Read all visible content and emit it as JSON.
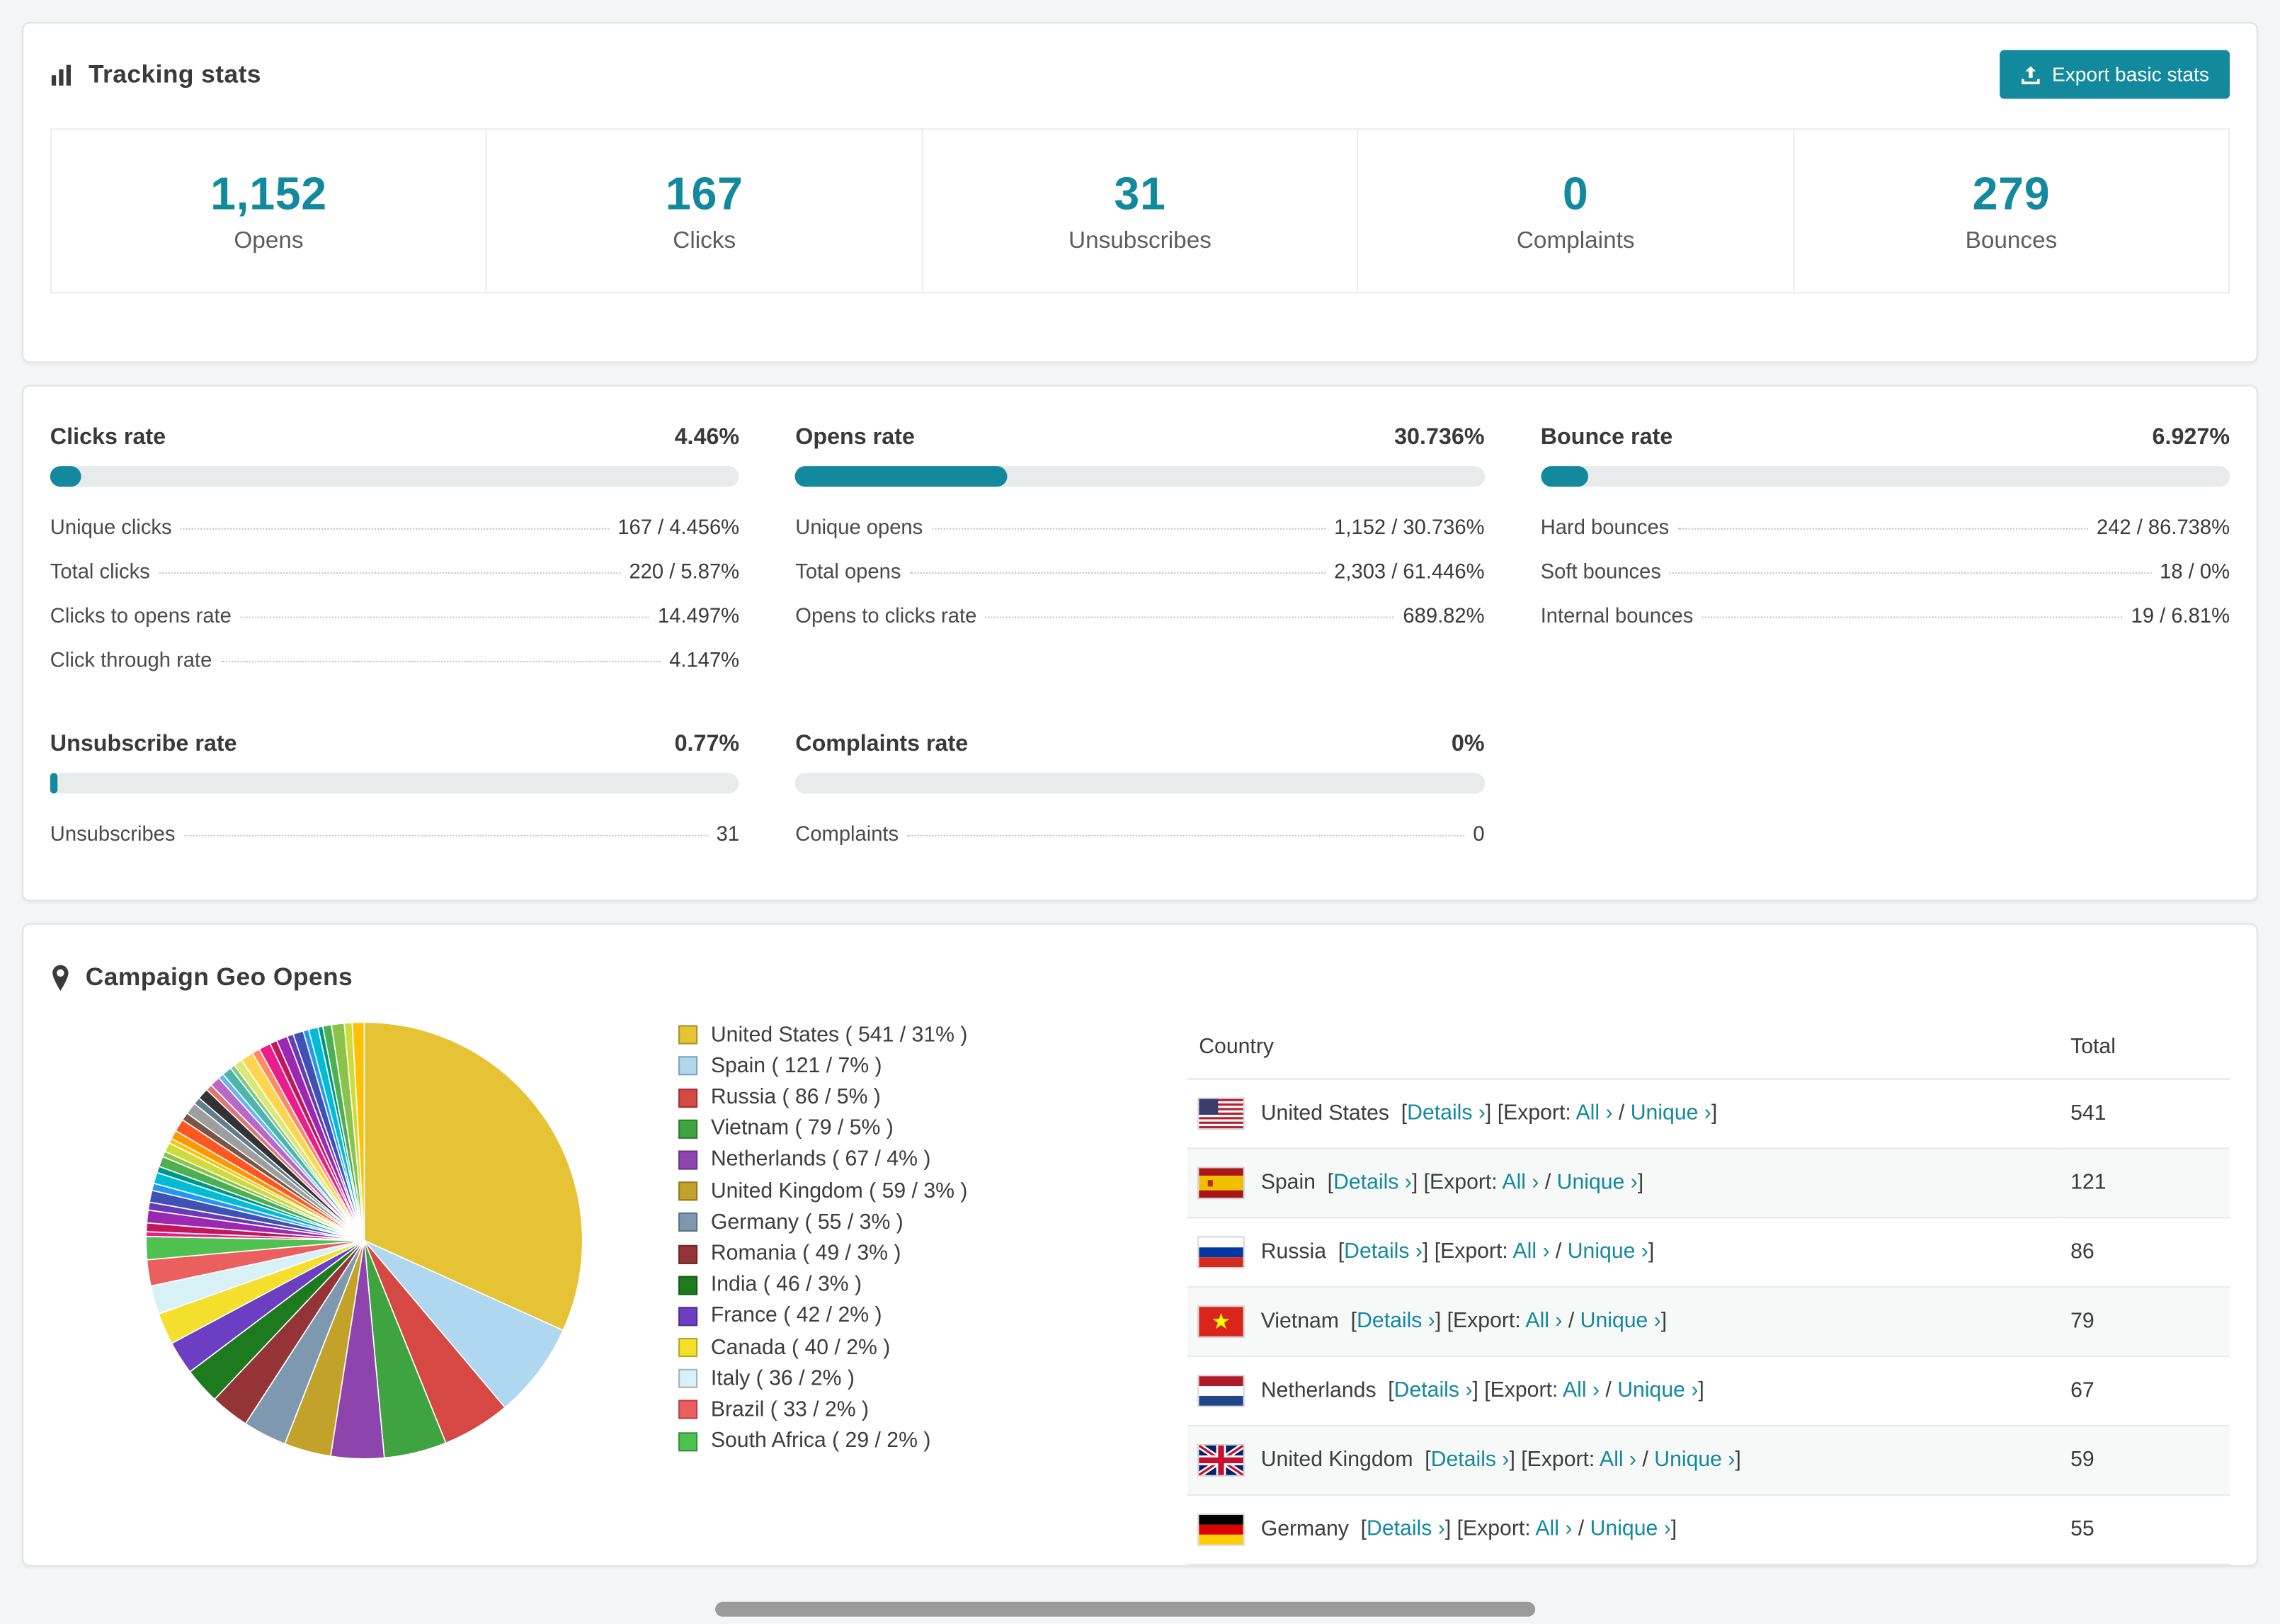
{
  "theme": {
    "accent": "#13899E"
  },
  "tracking": {
    "title": "Tracking stats",
    "export_button": "Export basic stats",
    "stats": [
      {
        "value": "1,152",
        "label": "Opens"
      },
      {
        "value": "167",
        "label": "Clicks"
      },
      {
        "value": "31",
        "label": "Unsubscribes"
      },
      {
        "value": "0",
        "label": "Complaints"
      },
      {
        "value": "279",
        "label": "Bounces"
      }
    ]
  },
  "rates": [
    {
      "title": "Clicks rate",
      "value": "4.46%",
      "percent": 4.46,
      "rows": [
        {
          "label": "Unique clicks",
          "value": "167 / 4.456%"
        },
        {
          "label": "Total clicks",
          "value": "220 / 5.87%"
        },
        {
          "label": "Clicks to opens rate",
          "value": "14.497%"
        },
        {
          "label": "Click through rate",
          "value": "4.147%"
        }
      ]
    },
    {
      "title": "Opens rate",
      "value": "30.736%",
      "percent": 30.736,
      "rows": [
        {
          "label": "Unique opens",
          "value": "1,152 / 30.736%"
        },
        {
          "label": "Total opens",
          "value": "2,303 / 61.446%"
        },
        {
          "label": "Opens to clicks rate",
          "value": "689.82%"
        }
      ]
    },
    {
      "title": "Bounce rate",
      "value": "6.927%",
      "percent": 6.927,
      "rows": [
        {
          "label": "Hard bounces",
          "value": "242 / 86.738%"
        },
        {
          "label": "Soft bounces",
          "value": "18 / 0%"
        },
        {
          "label": "Internal bounces",
          "value": "19 / 6.81%"
        }
      ]
    },
    {
      "title": "Unsubscribe rate",
      "value": "0.77%",
      "percent": 0.77,
      "rows": [
        {
          "label": "Unsubscribes",
          "value": "31"
        }
      ]
    },
    {
      "title": "Complaints rate",
      "value": "0%",
      "percent": 0,
      "rows": [
        {
          "label": "Complaints",
          "value": "0"
        }
      ]
    }
  ],
  "geo": {
    "title": "Campaign Geo Opens",
    "legend": [
      {
        "label": "United States ( 541 / 31% )",
        "color": "#E6C235"
      },
      {
        "label": "Spain ( 121 / 7% )",
        "color": "#AFD7F0"
      },
      {
        "label": "Russia ( 86 / 5% )",
        "color": "#D54843"
      },
      {
        "label": "Vietnam ( 79 / 5% )",
        "color": "#3FA33F"
      },
      {
        "label": "Netherlands ( 67 / 4% )",
        "color": "#8E44AD"
      },
      {
        "label": "United Kingdom ( 59 / 3% )",
        "color": "#C3A22B"
      },
      {
        "label": "Germany ( 55 / 3% )",
        "color": "#7E99AF"
      },
      {
        "label": "Romania ( 49 / 3% )",
        "color": "#943437"
      },
      {
        "label": "India ( 46 / 3% )",
        "color": "#1E7A1E"
      },
      {
        "label": "France ( 42 / 2% )",
        "color": "#6C3FC2"
      },
      {
        "label": "Canada ( 40 / 2% )",
        "color": "#F4E02C"
      },
      {
        "label": "Italy ( 36 / 2% )",
        "color": "#D8F1F6"
      },
      {
        "label": "Brazil ( 33 / 2% )",
        "color": "#EC5F5F"
      },
      {
        "label": "South Africa ( 29 / 2% )",
        "color": "#4FC150"
      }
    ],
    "table": {
      "headers": {
        "country": "Country",
        "total": "Total"
      },
      "link_details": "Details",
      "export_prefix": "Export:",
      "link_all": "All",
      "link_unique": "Unique",
      "chevron": "›",
      "bracket_open": "[",
      "bracket_close": "]",
      "slash": "/",
      "rows": [
        {
          "flag": "us",
          "country": "United States",
          "total": "541"
        },
        {
          "flag": "es",
          "country": "Spain",
          "total": "121"
        },
        {
          "flag": "ru",
          "country": "Russia",
          "total": "86"
        },
        {
          "flag": "vn",
          "country": "Vietnam",
          "total": "79"
        },
        {
          "flag": "nl",
          "country": "Netherlands",
          "total": "67"
        },
        {
          "flag": "gb",
          "country": "United Kingdom",
          "total": "59"
        },
        {
          "flag": "de",
          "country": "Germany",
          "total": "55"
        }
      ]
    }
  },
  "chart_data": {
    "type": "pie",
    "title": "Campaign Geo Opens",
    "labels": [
      "United States",
      "Spain",
      "Russia",
      "Vietnam",
      "Netherlands",
      "United Kingdom",
      "Germany",
      "Romania",
      "India",
      "France",
      "Canada",
      "Italy",
      "Brazil",
      "South Africa"
    ],
    "values": [
      541,
      121,
      86,
      79,
      67,
      59,
      55,
      49,
      46,
      42,
      40,
      36,
      33,
      29
    ],
    "percents": [
      31,
      7,
      5,
      5,
      4,
      3,
      3,
      3,
      3,
      2,
      2,
      2,
      2,
      2
    ],
    "colors": [
      "#E6C235",
      "#AFD7F0",
      "#D54843",
      "#3FA33F",
      "#8E44AD",
      "#C3A22B",
      "#7E99AF",
      "#943437",
      "#1E7A1E",
      "#6C3FC2",
      "#F4E02C",
      "#D8F1F6",
      "#EC5F5F",
      "#4FC150"
    ],
    "other_unlabeled": {
      "approx_percent": 26,
      "segment_count": 38
    },
    "other_palette": [
      "#E91E8C",
      "#C2185B",
      "#9C27B0",
      "#673AB7",
      "#3F51B5",
      "#2196F3",
      "#00BCD4",
      "#009688",
      "#4CAF50",
      "#8BC34A",
      "#CDDC39",
      "#FFC107",
      "#FF9800",
      "#FF5722",
      "#795548",
      "#9E9E9E",
      "#607D8B",
      "#333333",
      "#E57373",
      "#BA68C8",
      "#64B5F6",
      "#4DB6AC",
      "#81C784",
      "#DCE775",
      "#FFD54F",
      "#FF8A65"
    ],
    "legend_position": "right"
  }
}
